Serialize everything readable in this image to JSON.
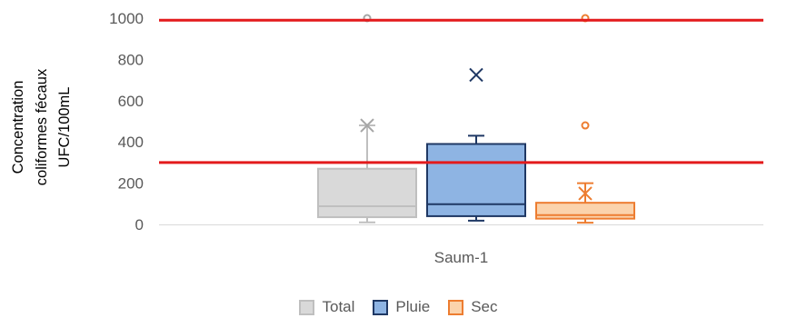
{
  "chart_data": {
    "type": "box",
    "ylabel_lines": [
      "Concentration",
      "coliformes fécaux",
      "UFC/100mL"
    ],
    "categories": [
      "Saum-1"
    ],
    "ylim": [
      0,
      1000
    ],
    "yticks": [
      0,
      200,
      400,
      600,
      800,
      1000
    ],
    "grid": false,
    "legend_position": "bottom",
    "reference_lines": [
      {
        "y": 990,
        "color": "#e31a1c"
      },
      {
        "y": 300,
        "color": "#e31a1c"
      }
    ],
    "series": [
      {
        "name": "Total",
        "fill": "#d9d9d9",
        "stroke": "#bfbfbf",
        "marker_color": "#a6a6a6",
        "min": 10,
        "q1": 35,
        "median": 88,
        "q3": 270,
        "max": 480,
        "mean": 480,
        "outliers": [
          1000
        ]
      },
      {
        "name": "Pluie",
        "fill": "#8eb4e3",
        "stroke": "#1f3864",
        "marker_color": "#1f3864",
        "min": 18,
        "q1": 40,
        "median": 98,
        "q3": 390,
        "max": 430,
        "mean": 725,
        "outliers": []
      },
      {
        "name": "Sec",
        "fill": "#fbd3ac",
        "stroke": "#ed7d31",
        "marker_color": "#ed7d31",
        "min": 8,
        "q1": 28,
        "median": 45,
        "q3": 105,
        "max": 200,
        "mean": 150,
        "outliers": [
          480,
          1000
        ]
      }
    ]
  }
}
